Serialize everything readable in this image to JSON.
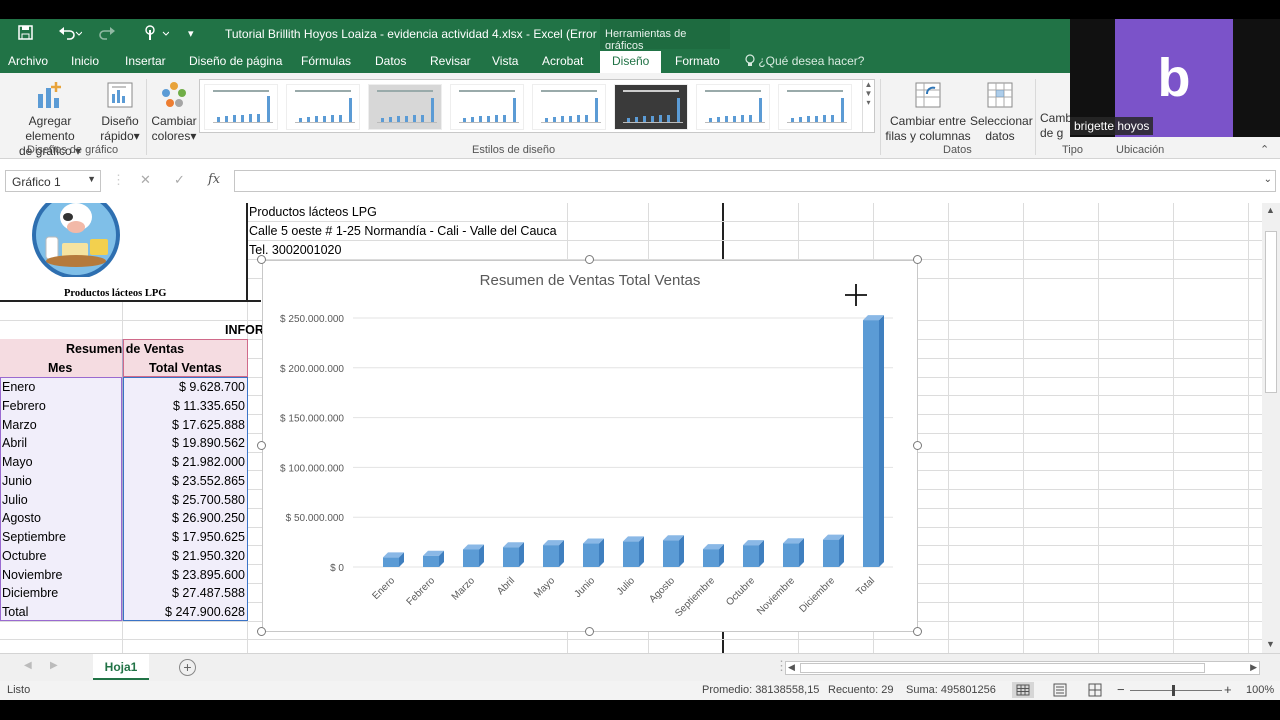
{
  "window": {
    "title": "Tutorial Brillith Hoyos Loaiza - evidencia actividad 4.xlsx - Excel (Error d...",
    "context_title": "Herramientas de gráficos"
  },
  "ribbon_tabs": [
    "Archivo",
    "Inicio",
    "Insertar",
    "Diseño de página",
    "Fórmulas",
    "Datos",
    "Revisar",
    "Vista",
    "Acrobat",
    "Diseño",
    "Formato"
  ],
  "search_placeholder": "¿Qué desea hacer?",
  "ribbon": {
    "add_element": [
      "Agregar elemento",
      "de gráfico"
    ],
    "quick_layout": [
      "Diseño",
      "rápido"
    ],
    "change_colors": [
      "Cambiar",
      "colores"
    ],
    "switch_rows": [
      "Cambiar entre",
      "filas y columnas"
    ],
    "select_data": [
      "Seleccionar",
      "datos"
    ],
    "change_type_partial": [
      "Camb",
      "de g"
    ],
    "groups": {
      "layouts": "Diseños de gráfico",
      "styles": "Estilos de diseño",
      "data": "Datos",
      "type": "Tipo",
      "location": "Ubicación"
    }
  },
  "video": {
    "initial": "b",
    "name": "brigette hoyos"
  },
  "name_box": "Gráfico 1",
  "company": {
    "logo_caption": "Productos lácteos LPG",
    "name": "Productos lácteos LPG",
    "address": "Calle 5 oeste # 1-25 Normandía - Cali - Valle del Cauca",
    "phone": "Tel. 3002001020",
    "report_partial": "INFOR"
  },
  "table": {
    "title": "Resumen de Ventas",
    "headers": [
      "Mes",
      "Total Ventas"
    ],
    "rows": [
      [
        "Enero",
        "$ 9.628.700"
      ],
      [
        "Febrero",
        "$ 11.335.650"
      ],
      [
        "Marzo",
        "$ 17.625.888"
      ],
      [
        "Abril",
        "$ 19.890.562"
      ],
      [
        "Mayo",
        "$ 21.982.000"
      ],
      [
        "Junio",
        "$ 23.552.865"
      ],
      [
        "Julio",
        "$ 25.700.580"
      ],
      [
        "Agosto",
        "$ 26.900.250"
      ],
      [
        "Septiembre",
        "$ 17.950.625"
      ],
      [
        "Octubre",
        "$ 21.950.320"
      ],
      [
        "Noviembre",
        "$ 23.895.600"
      ],
      [
        "Diciembre",
        "$ 27.487.588"
      ],
      [
        "Total",
        "$ 247.900.628"
      ]
    ]
  },
  "chart_data": {
    "type": "bar",
    "title": "Resumen de Ventas Total Ventas",
    "categories": [
      "Enero",
      "Febrero",
      "Marzo",
      "Abril",
      "Mayo",
      "Junio",
      "Julio",
      "Agosto",
      "Septiembre",
      "Octubre",
      "Noviembre",
      "Diciembre",
      "Total"
    ],
    "values": [
      9628700,
      11335650,
      17625888,
      19890562,
      21982000,
      23552865,
      25700580,
      26900250,
      17950625,
      21950320,
      23895600,
      27487588,
      247900628
    ],
    "ytick_labels": [
      "$ 0",
      "$ 50.000.000",
      "$ 100.000.000",
      "$ 150.000.000",
      "$ 200.000.000",
      "$ 250.000.000"
    ],
    "ylim": [
      0,
      250000000
    ],
    "grid": true,
    "legend": "none",
    "bar_color": "#5b9bd5"
  },
  "sheet_tab": "Hoja1",
  "status": {
    "ready": "Listo",
    "average": "Promedio: 38138558,15",
    "count": "Recuento: 29",
    "sum": "Suma: 495801256",
    "zoom": "100%"
  },
  "colors": {
    "accent": "#217346"
  }
}
